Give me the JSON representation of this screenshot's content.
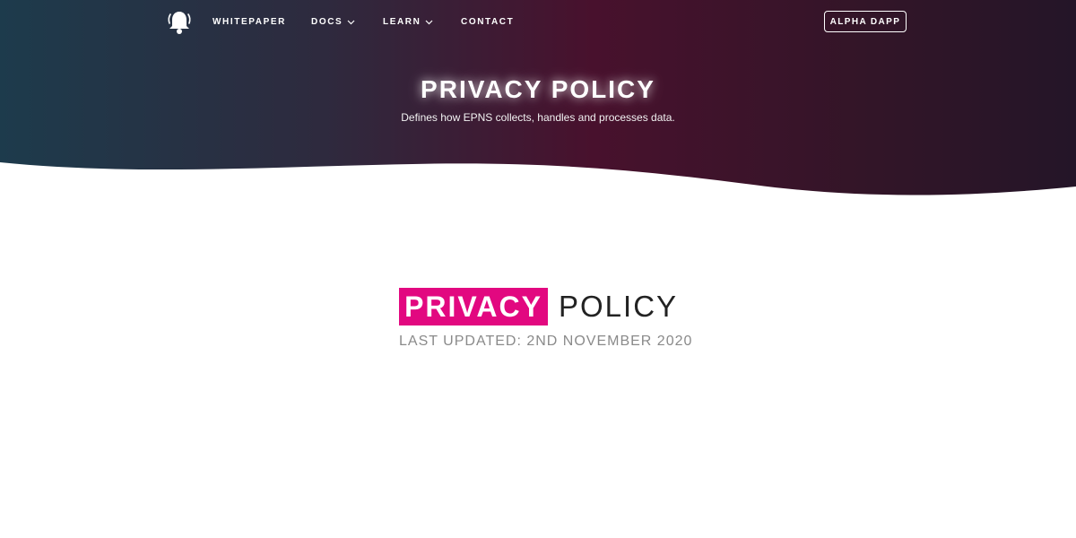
{
  "nav": {
    "logo_icon": "bell-icon",
    "links": [
      {
        "label": "WHITEPAPER",
        "has_dropdown": false
      },
      {
        "label": "DOCS",
        "has_dropdown": true
      },
      {
        "label": "LEARN",
        "has_dropdown": true
      },
      {
        "label": "CONTACT",
        "has_dropdown": false
      }
    ],
    "cta_label": "ALPHA DAPP"
  },
  "hero": {
    "title": "PRIVACY POLICY",
    "subtitle": "Defines how EPNS collects, handles and processes data."
  },
  "document": {
    "highlight_word": "PRIVACY",
    "title_rest": "POLICY",
    "last_updated": "LAST UPDATED: 2ND NOVEMBER 2020"
  },
  "colors": {
    "hero_gradient_left": "#1d3b4c",
    "hero_gradient_mid": "#48112d",
    "hero_gradient_right": "#241528",
    "accent_pink": "#e20880",
    "text_dark": "#222222",
    "text_gray": "#8a8a8a"
  }
}
